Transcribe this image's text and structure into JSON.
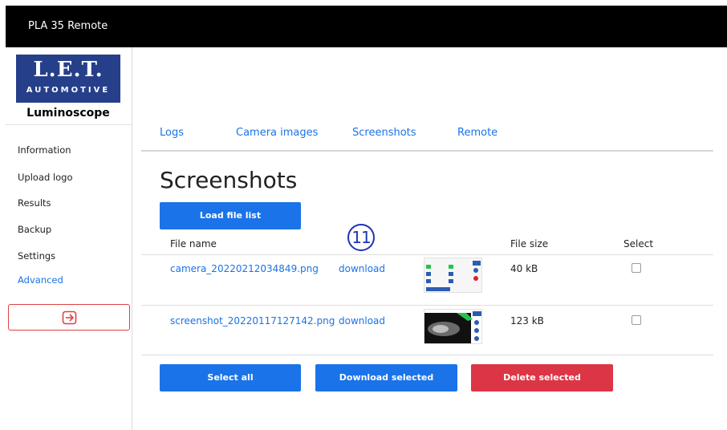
{
  "app": {
    "title": "PLA 35 Remote"
  },
  "logo": {
    "line1": "L.E.T.",
    "line2": "AUTOMOTIVE",
    "line3": "Luminoscope"
  },
  "sidebar": {
    "items": [
      {
        "label": "Information"
      },
      {
        "label": "Upload logo"
      },
      {
        "label": "Results"
      },
      {
        "label": "Backup"
      },
      {
        "label": "Settings"
      },
      {
        "label": "Advanced"
      }
    ],
    "logout_icon": "logout-icon"
  },
  "tabs": [
    {
      "label": "Logs"
    },
    {
      "label": "Camera images"
    },
    {
      "label": "Screenshots"
    },
    {
      "label": "Remote"
    }
  ],
  "page": {
    "title": "Screenshots",
    "load_button": "Load file list",
    "marker": "11"
  },
  "table": {
    "headers": {
      "name": "File name",
      "size": "File size",
      "select": "Select"
    },
    "rows": [
      {
        "name": "camera_20220212034849.png",
        "download": "download",
        "size": "40 kB",
        "selected": false
      },
      {
        "name": "screenshot_20220117127142.png",
        "download": "download",
        "size": "123 kB",
        "selected": false
      }
    ]
  },
  "actions": {
    "select_all": "Select all",
    "download_selected": "Download selected",
    "delete_selected": "Delete selected"
  },
  "colors": {
    "accent": "#1a73e8",
    "danger": "#dc3545",
    "topbar": "#000000",
    "marker": "#1f33b5"
  }
}
